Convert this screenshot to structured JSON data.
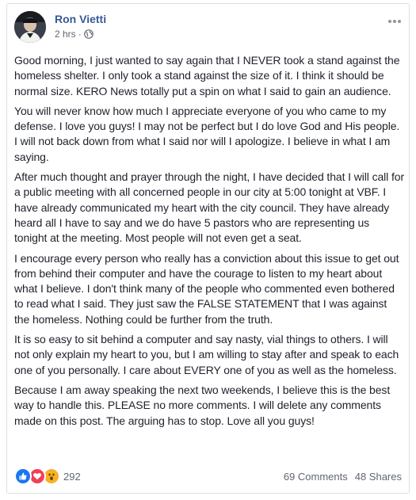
{
  "post": {
    "author": "Ron Vietti",
    "time": "2 hrs",
    "separator": "·",
    "privacy_icon": "globe-icon",
    "more_icon": "more-options-icon",
    "paragraphs": [
      "Good morning, I just wanted to say again that I NEVER took a stand against the homeless shelter. I only took a stand against the size of it. I think it should be normal size. KERO News totally put a spin on what I said to gain an audience.",
      "You will never know how much I appreciate everyone of you who came to my defense. I love you guys! I may not be perfect but I do love God and His people. I will not back down from what I said nor will I apologize. I believe in what I am saying.",
      "After much thought and prayer through the night, I have decided that I will call for a public meeting with all concerned people in our city at 5:00 tonight at VBF. I have already communicated my heart with the city council. They have already heard all I have to say and we do have 5 pastors who are representing us tonight at the meeting. Most people will not even get a seat.",
      "I encourage every person who really has a conviction about this issue to get out from behind their computer and have the courage to listen to my heart about what I believe. I don't think many of the people who commented even bothered to read what I said. They just saw the FALSE STATEMENT that I was against the homeless. Nothing could be further from the truth.",
      "It is so easy to sit behind a computer and say nasty, vial things to others. I will not only explain my heart to you, but I am willing to stay after and speak to each one of you personally. I care about EVERY one of you as well as the homeless.",
      "Because I am away speaking the next two weekends, I believe this is the best way to handle this. PLEASE no more comments. I will delete any comments made on this post. The arguing has to stop. Love all you guys!"
    ]
  },
  "footer": {
    "reaction_icons": [
      "like-reaction-icon",
      "love-reaction-icon",
      "wow-reaction-icon"
    ],
    "reaction_count": "292",
    "comments": "69 Comments",
    "shares": "48 Shares"
  },
  "colors": {
    "author_link": "#385898",
    "meta_text": "#616770",
    "like": "#1877f2",
    "love": "#f33e58",
    "wow": "#f7b125"
  }
}
